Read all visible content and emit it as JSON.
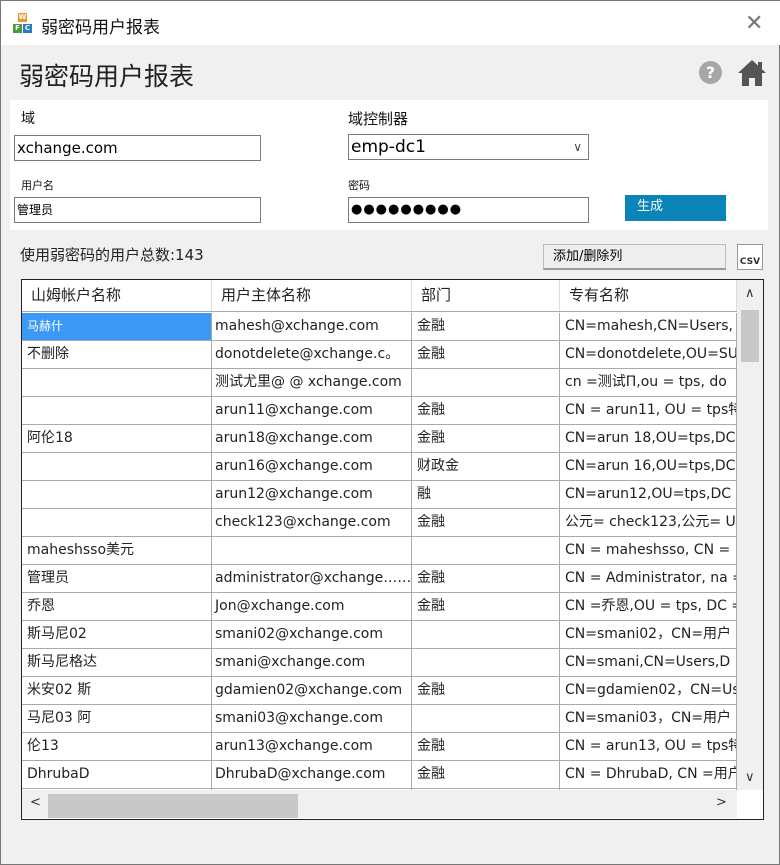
{
  "window": {
    "title": "弱密码用户报表",
    "close": "✕"
  },
  "page": {
    "title": "弱密码用户报表",
    "help": "?"
  },
  "form": {
    "domain_label": "域",
    "domain_value": "xchange.com",
    "dc_label": "域控制器",
    "dc_value": "emp-dc1",
    "user_label": "用户名",
    "user_value": "管理员",
    "pwd_label": "密码",
    "pwd_value": "●●●●●●●●●",
    "generate": "生成"
  },
  "summary": {
    "count_text": "使用弱密码的用户总数:143",
    "add_remove_columns": "添加/删除列",
    "csv": "CSV"
  },
  "table": {
    "columns": [
      "山姆帐户名称",
      "用户主体名称",
      "部门",
      "专有名称"
    ],
    "rows": [
      [
        "马赫什",
        "mahesh@xchange.com",
        "金融",
        "CN=mahesh,CN=Users,"
      ],
      [
        "不删除",
        "donotdelete@xchange.c。",
        "金融",
        "CN=donotdelete,OU=SU"
      ],
      [
        "",
        "测试尤里@ @ xchange.com",
        "",
        "cn =测试Π,ou = tps, do"
      ],
      [
        "",
        "arun11@xchange.com",
        "金融",
        "CN = arun11, OU = tps特区"
      ],
      [
        "阿伦18",
        "arun18@xchange.com",
        "金融",
        "CN=arun 18,OU=tps,DC"
      ],
      [
        "",
        "arun16@xchange.com",
        "财政金",
        "CN=arun 16,OU=tps,DC"
      ],
      [
        "",
        "arun12@xchange.com",
        "融",
        "CN=arun12,OU=tps,DC"
      ],
      [
        "",
        "check123@xchange.com",
        "金融",
        "公元= check123,公元= User"
      ],
      [
        "maheshsso美元",
        "",
        "",
        "CN = maheshsso, CN ="
      ],
      [
        "管理员",
        "administrator@xchange……",
        "金融",
        "CN = Administrator, na = L"
      ],
      [
        "乔恩",
        "Jon@xchange.com",
        "金融",
        "CN =乔恩,OU = tps, DC =我"
      ],
      [
        "斯马尼02",
        "smani02@xchange.com",
        "",
        "CN=smani02，CN=用户"
      ],
      [
        "斯马尼格达",
        "smani@xchange.com",
        "",
        "CN=smani,CN=Users,D"
      ],
      [
        "米安02 斯",
        "gdamien02@xchange.com",
        "金融",
        "CN=gdamien02，CN=Use"
      ],
      [
        "马尼03 阿",
        "smani03@xchange.com",
        "",
        "CN=smani03，CN=用户"
      ],
      [
        "伦13",
        "arun13@xchange.com",
        "金融",
        "CN = arun13, OU = tps特区"
      ],
      [
        "DhrubaD",
        "DhrubaD@xchange.com",
        "金融",
        "CN = DhrubaD, CN =用户"
      ],
      [
        "",
        "",
        "",
        ""
      ]
    ]
  },
  "colors": {
    "accent": "#0a84b9",
    "selection": "#3b99f5"
  }
}
